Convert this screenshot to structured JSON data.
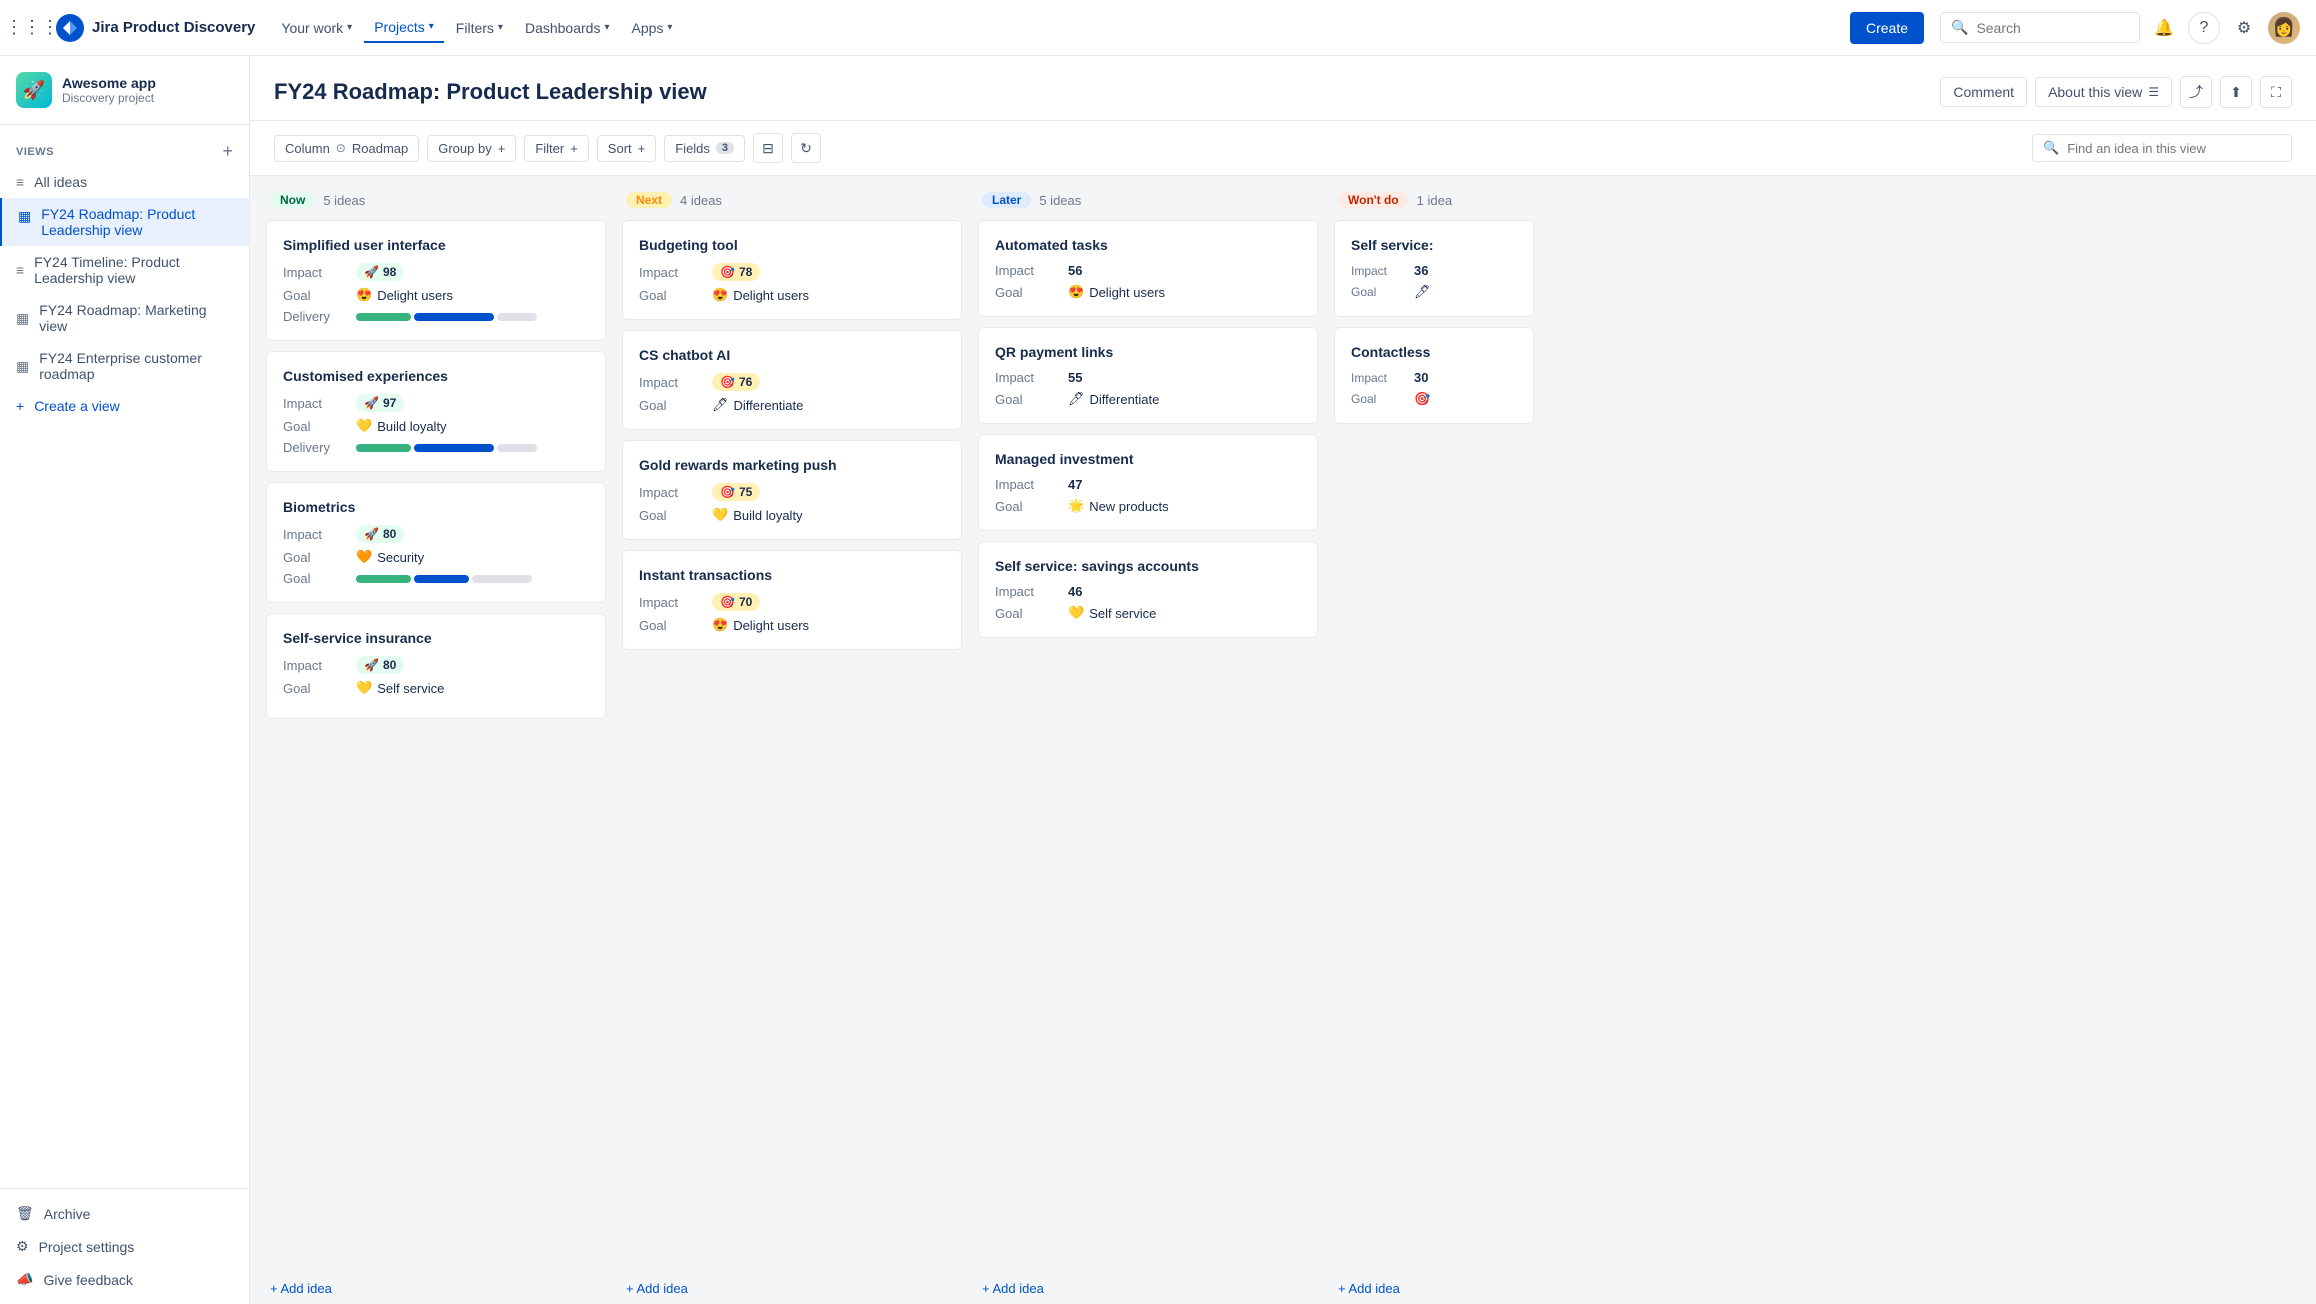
{
  "app": {
    "logo_text": "Jira Product Discovery"
  },
  "topnav": {
    "links": [
      {
        "label": "Your work",
        "chevron": true,
        "active": false
      },
      {
        "label": "Projects",
        "chevron": true,
        "active": true
      },
      {
        "label": "Filters",
        "chevron": true,
        "active": false
      },
      {
        "label": "Dashboards",
        "chevron": true,
        "active": false
      },
      {
        "label": "Apps",
        "chevron": true,
        "active": false
      }
    ],
    "create_label": "Create",
    "search_placeholder": "Search"
  },
  "sidebar": {
    "project_name": "Awesome app",
    "project_sub": "Discovery project",
    "views_label": "VIEWS",
    "add_view_label": "+",
    "items": [
      {
        "id": "all-ideas",
        "label": "All ideas",
        "icon": "≡",
        "active": false
      },
      {
        "id": "fy24-roadmap-leadership",
        "label": "FY24 Roadmap: Product Leadership view",
        "icon": "▦",
        "active": true
      },
      {
        "id": "fy24-timeline-leadership",
        "label": "FY24 Timeline: Product Leadership view",
        "icon": "≡",
        "active": false
      },
      {
        "id": "fy24-roadmap-marketing",
        "label": "FY24 Roadmap: Marketing view",
        "icon": "▦",
        "active": false
      },
      {
        "id": "fy24-enterprise-roadmap",
        "label": "FY24 Enterprise customer roadmap",
        "icon": "▦",
        "active": false
      },
      {
        "id": "create-view",
        "label": "Create a view",
        "icon": "+",
        "active": false
      }
    ],
    "footer_items": [
      {
        "id": "archive",
        "label": "Archive",
        "icon": "🗑"
      },
      {
        "id": "project-settings",
        "label": "Project settings",
        "icon": "⚙"
      },
      {
        "id": "give-feedback",
        "label": "Give feedback",
        "icon": "📣"
      }
    ]
  },
  "main": {
    "title": "FY24 Roadmap: Product Leadership view",
    "actions": {
      "comment_label": "Comment",
      "about_label": "About this view"
    }
  },
  "toolbar": {
    "column_label": "Column",
    "roadmap_label": "Roadmap",
    "group_by_label": "Group by",
    "filter_label": "Filter",
    "sort_label": "Sort",
    "fields_label": "Fields",
    "fields_count": "3",
    "search_placeholder": "Find an idea in this view"
  },
  "board": {
    "columns": [
      {
        "id": "now",
        "tag": "Now",
        "tag_type": "now",
        "count": 5,
        "count_label": "5 ideas",
        "cards": [
          {
            "title": "Simplified user interface",
            "impact": 98,
            "impact_emoji": "🚀",
            "goal": "Delight users",
            "goal_emoji": "😍",
            "delivery": {
              "green": 45,
              "blue": 80,
              "gray": 30
            },
            "has_delivery": true
          },
          {
            "title": "Customised experiences",
            "impact": 97,
            "impact_emoji": "🚀",
            "goal": "Build loyalty",
            "goal_emoji": "💛",
            "delivery": {
              "green": 45,
              "blue": 80,
              "gray": 30
            },
            "has_delivery": true
          },
          {
            "title": "Biometrics",
            "impact": 80,
            "impact_emoji": "🚀",
            "goal": "Security",
            "goal_emoji": "🧡",
            "delivery": {
              "green": 45,
              "blue": 60,
              "gray": 50
            },
            "has_delivery": true
          },
          {
            "title": "Self-service insurance",
            "impact": 80,
            "impact_emoji": "🚀",
            "goal": "Self service",
            "goal_emoji": "💛",
            "has_delivery": false
          }
        ],
        "add_idea_label": "+ Add idea"
      },
      {
        "id": "next",
        "tag": "Next",
        "tag_type": "next",
        "count": 4,
        "count_label": "4 ideas",
        "cards": [
          {
            "title": "Budgeting tool",
            "impact": 78,
            "impact_emoji": "🎯",
            "goal": "Delight users",
            "goal_emoji": "😍",
            "has_delivery": false
          },
          {
            "title": "CS chatbot AI",
            "impact": 76,
            "impact_emoji": "🎯",
            "goal": "Differentiate",
            "goal_emoji": "🖊",
            "has_delivery": false
          },
          {
            "title": "Gold rewards marketing push",
            "impact": 75,
            "impact_emoji": "🎯",
            "goal": "Build loyalty",
            "goal_emoji": "💛",
            "has_delivery": false
          },
          {
            "title": "Instant transactions",
            "impact": 70,
            "impact_emoji": "🎯",
            "goal": "Delight users",
            "goal_emoji": "😍",
            "has_delivery": false
          }
        ],
        "add_idea_label": "+ Add idea"
      },
      {
        "id": "later",
        "tag": "Later",
        "tag_type": "later",
        "count": 5,
        "count_label": "5 ideas",
        "cards": [
          {
            "title": "Automated tasks",
            "impact": 56,
            "impact_emoji": "",
            "goal": "Delight users",
            "goal_emoji": "😍",
            "has_delivery": false
          },
          {
            "title": "QR payment links",
            "impact": 55,
            "impact_emoji": "",
            "goal": "Differentiate",
            "goal_emoji": "🖊",
            "has_delivery": false
          },
          {
            "title": "Managed investment",
            "impact": 47,
            "impact_emoji": "",
            "goal": "New products",
            "goal_emoji": "🌟",
            "has_delivery": false
          },
          {
            "title": "Self service: savings accounts",
            "impact": 46,
            "impact_emoji": "",
            "goal": "Self service",
            "goal_emoji": "💛",
            "has_delivery": false
          }
        ],
        "add_idea_label": "+ Add idea"
      },
      {
        "id": "wontdo",
        "tag": "Won't do",
        "tag_type": "wontdo",
        "count": 1,
        "count_label": "1 idea",
        "cards": [
          {
            "title": "Self service:",
            "impact": 36,
            "impact_emoji": "",
            "goal": "",
            "goal_emoji": "🖊",
            "has_delivery": false,
            "partial": true
          },
          {
            "title": "Contactless",
            "impact": 30,
            "impact_emoji": "",
            "goal": "",
            "goal_emoji": "🎯",
            "has_delivery": false,
            "partial": true
          }
        ],
        "add_idea_label": "+ Add idea"
      }
    ]
  }
}
